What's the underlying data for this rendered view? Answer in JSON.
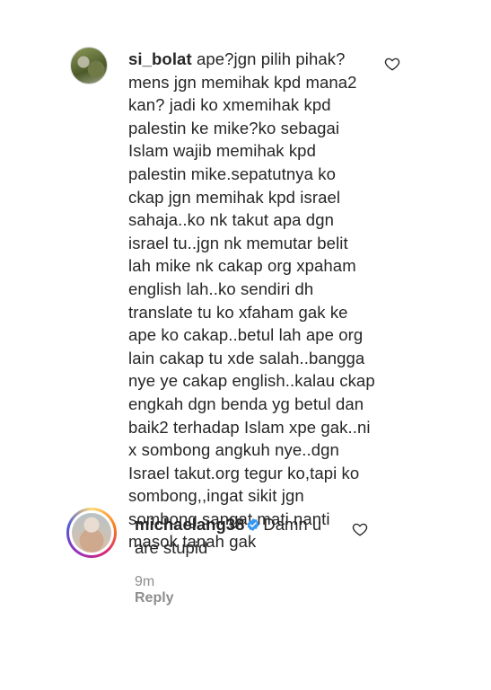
{
  "comments": [
    {
      "username": "si_bolat",
      "text": "ape?jgn pilih pihak?\nmens jgn memihak kpd mana2\nkan? jadi ko xmemihak kpd\npalestin ke mike?ko sebagai\nIslam wajib memihak kpd\npalestin mike.sepatutnya ko\nckap jgn memihak kpd israel\nsahaja..ko nk takut apa dgn\nisrael tu..jgn nk memutar belit\nlah mike nk cakap org xpaham\nenglish lah..ko sendiri dh\ntranslate tu ko xfaham gak ke\nape ko cakap..betul lah ape org\nlain cakap tu xde salah..bangga\nnye ye cakap english..kalau ckap\nengkah dgn benda yg betul dan\nbaik2 terhadap Islam xpe gak..ni\nx sombong angkuh nye..dgn\nIsrael takut.org tegur ko,tapi ko\nsombong,,ingat sikit jgn\nsombong sangat mati nanti\nmasok tanah gak",
      "like_icon": "heart-outline-icon"
    },
    {
      "username": "michaelang38",
      "verified": true,
      "text": "Damn u are stupid",
      "like_icon": "heart-outline-icon",
      "time": "9m",
      "reply_label": "Reply"
    }
  ],
  "colors": {
    "text": "#262626",
    "meta": "#8e8e8e",
    "verified": "#3897f0"
  }
}
